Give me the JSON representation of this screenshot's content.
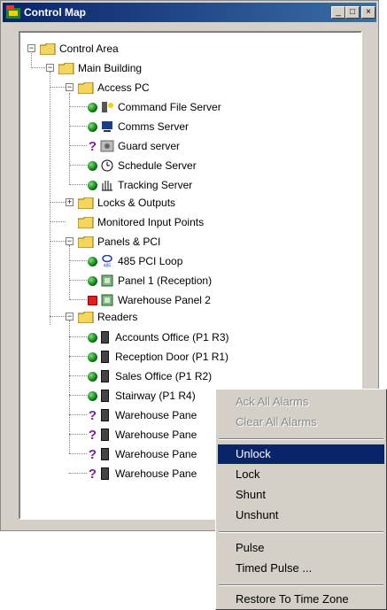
{
  "window": {
    "title": "Control Map",
    "controls": {
      "minimize": "_",
      "maximize": "□",
      "close": "×"
    }
  },
  "tree": {
    "control_area": "Control Area",
    "main_building": "Main Building",
    "access_pc": {
      "label": "Access PC",
      "items": [
        "Command File Server",
        "Comms Server",
        "Guard server",
        "Schedule Server",
        "Tracking Server"
      ]
    },
    "locks_outputs": "Locks & Outputs",
    "monitored_inputs": "Monitored Input Points",
    "panels": {
      "label": "Panels  & PCI",
      "items": [
        "485 PCI Loop",
        "Panel 1 (Reception)",
        "Warehouse Panel 2"
      ],
      "loop_badge": "485"
    },
    "readers": {
      "label": "Readers",
      "items": [
        "Accounts Office  (P1 R3)",
        "Reception Door  (P1 R1)",
        "Sales Office  (P1 R2)",
        "Stairway  (P1 R4)",
        "Warehouse Pane",
        "Warehouse Pane",
        "Warehouse Pane",
        "Warehouse Pane"
      ]
    },
    "unknown_mark": "?"
  },
  "context_menu": {
    "items": [
      "Ack All Alarms",
      "Clear All Alarms",
      "Unlock",
      "Lock",
      "Shunt",
      "Unshunt",
      "Pulse",
      "Timed Pulse ...",
      "Restore To Time Zone"
    ],
    "selected": "Unlock",
    "disabled": [
      "Ack All Alarms",
      "Clear All Alarms"
    ]
  },
  "colors": {
    "title_bar": "#0a246a",
    "ok_led": "#0a7a0a",
    "alarm_led": "#e51c1c",
    "unknown": "#7a1fa0",
    "selection": "#0a246a"
  },
  "icons": [
    "folder-icon",
    "status-ok-icon",
    "status-alarm-icon",
    "status-unknown-icon",
    "server-icon",
    "clock-icon",
    "reader-icon",
    "loop-icon",
    "panel-icon"
  ]
}
